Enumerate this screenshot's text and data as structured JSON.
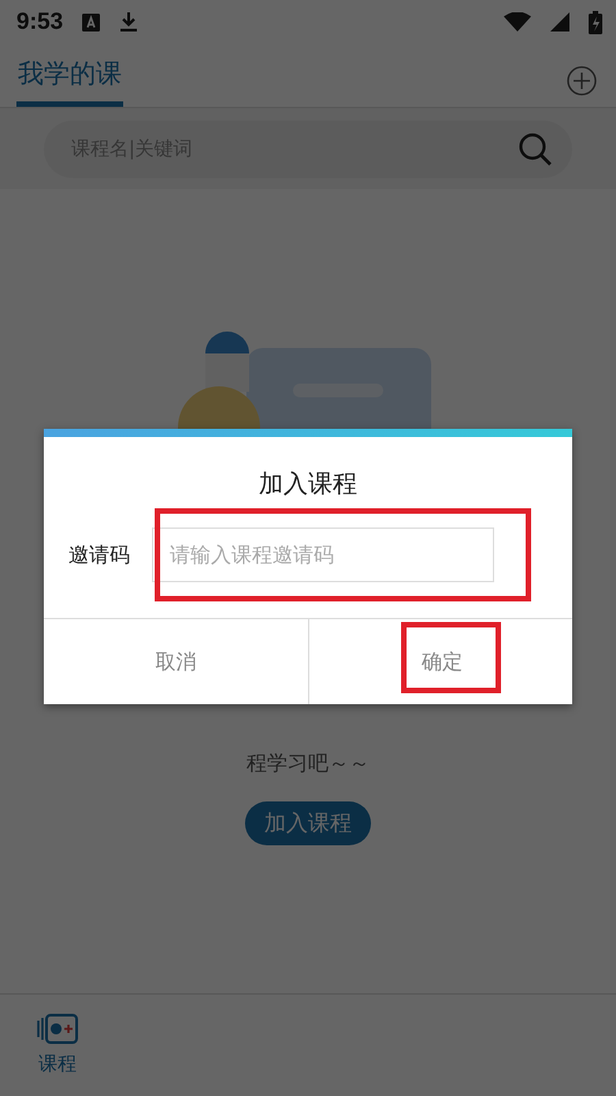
{
  "status_bar": {
    "time": "9:53"
  },
  "header": {
    "tabs": [
      {
        "label": "我学的课",
        "selected": true
      }
    ]
  },
  "search": {
    "placeholder": "课程名|关键词"
  },
  "empty_state": {
    "message": "程学习吧～～",
    "button": "加入课程"
  },
  "bottom_nav": {
    "items": [
      {
        "label": "课程",
        "selected": true
      }
    ]
  },
  "dialog": {
    "title": "加入课程",
    "field_label": "邀请码",
    "placeholder": "请输入课程邀请码",
    "field_highlighted": true,
    "buttons": [
      {
        "label": "取消",
        "kind": "cancel",
        "highlighted": false
      },
      {
        "label": "确定",
        "kind": "confirm",
        "highlighted": true
      }
    ]
  }
}
